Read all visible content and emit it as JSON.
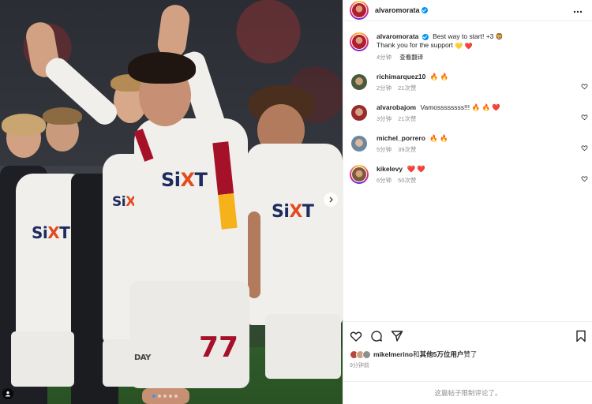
{
  "post": {
    "author": "alvaromorata",
    "caption_text": "Best way to start! +3",
    "caption_line2": "Thank you for the support",
    "caption_time": "4分钟",
    "see_translation": "查看翻译",
    "carousel_dots": 5,
    "active_dot": 0
  },
  "comments": [
    {
      "user": "richimarquez10",
      "emojis": "🔥 🔥",
      "time": "2分钟",
      "likes": "21次赞"
    },
    {
      "user": "alvarobajom",
      "text": "Vamossssssss!!!",
      "emojis": "🔥 🔥 ❤️",
      "time": "3分钟",
      "likes": "21次赞"
    },
    {
      "user": "michel_porrero",
      "emojis": "🔥 🔥",
      "time": "5分钟",
      "likes": "39次赞"
    },
    {
      "user": "kikelevy",
      "emojis": "❤️ ❤️",
      "time": "6分钟",
      "likes": "50次赞"
    }
  ],
  "likes": {
    "liker": "mikelmerino",
    "joiner": "和",
    "others": "其他5万位用户",
    "suffix": "赞了"
  },
  "posted_time": "9分钟前",
  "comments_limited": "这篇帖子限制评论了。",
  "icons": [
    "more-icon",
    "heart-icon",
    "comment-icon",
    "share-icon",
    "bookmark-icon",
    "chevron-right-icon",
    "user-tag-icon"
  ],
  "colors": {
    "accent": "#0095f6",
    "secondary_text": "#8e8e8e",
    "divider": "#efefef",
    "heart": "#ed4956"
  },
  "photo": {
    "sponsor_prefix": "Si",
    "sponsor_accent": "X",
    "sponsor_suffix": "T",
    "back_number": "77",
    "sleeve_text": "DAY"
  }
}
